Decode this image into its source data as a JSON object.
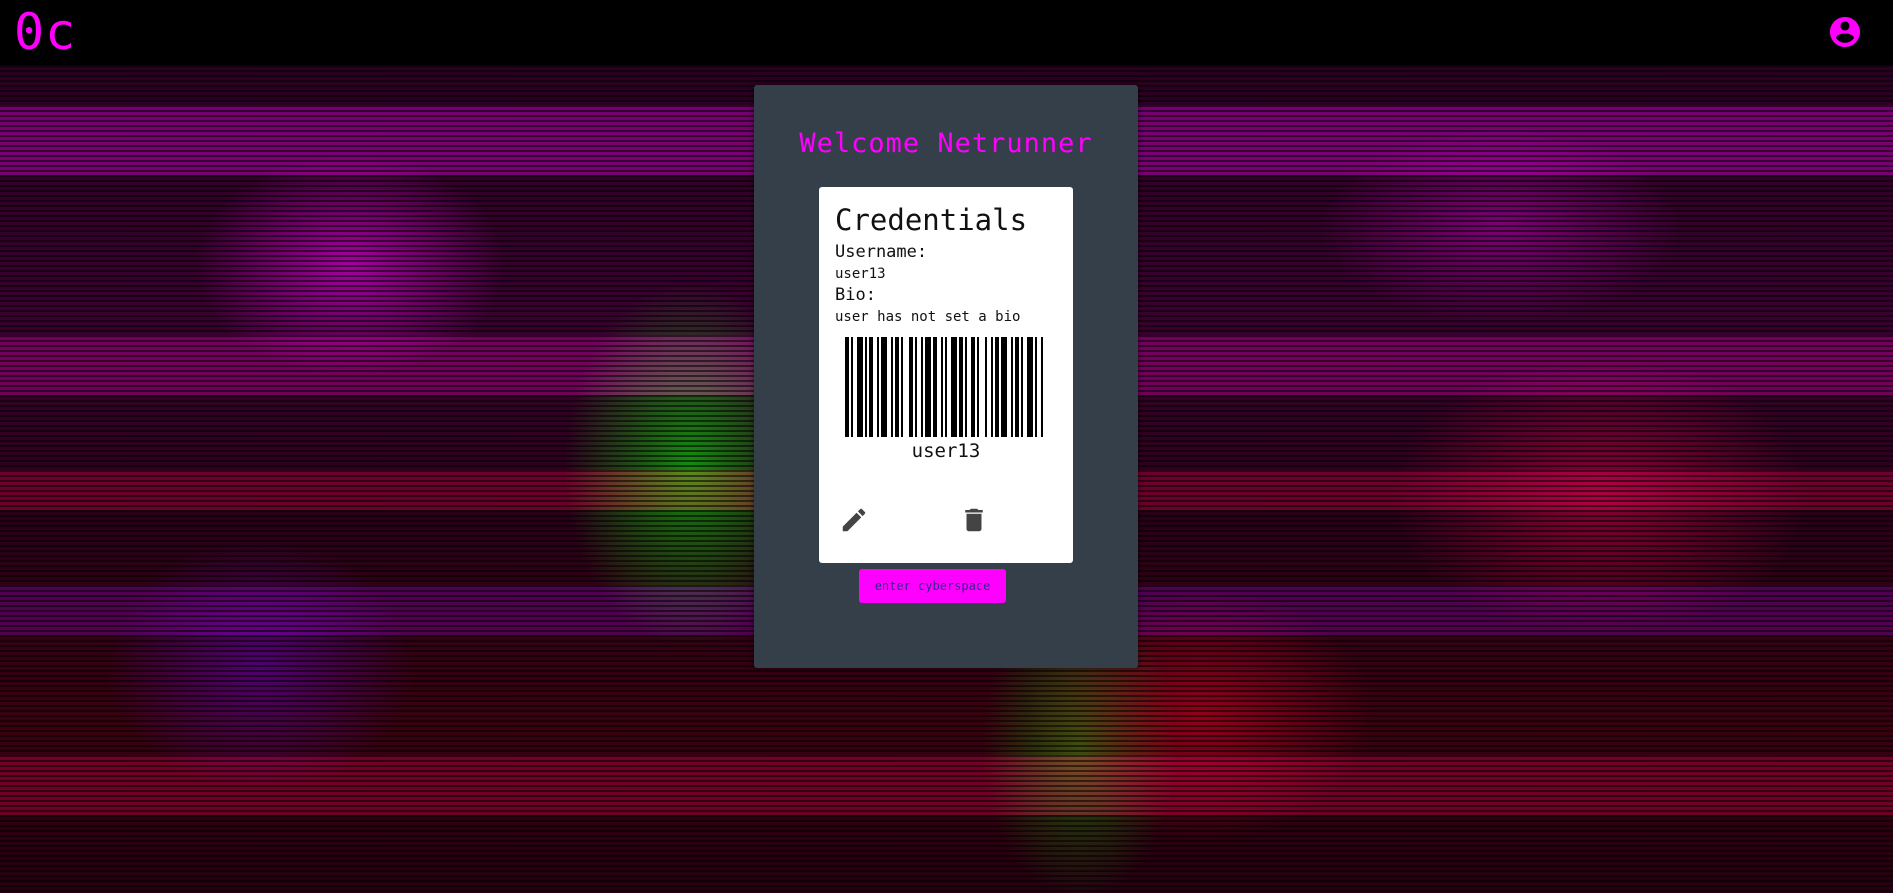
{
  "header": {
    "logo": "0c",
    "avatar_icon": "account-circle-icon"
  },
  "panel": {
    "welcome": "Welcome Netrunner",
    "card": {
      "title": "Credentials",
      "username_label": "Username:",
      "username_value": "user13",
      "bio_label": "Bio:",
      "bio_value": "user has not set a bio",
      "barcode_text": "user13",
      "edit_icon": "pencil-icon",
      "delete_icon": "trash-icon"
    },
    "enter_button": "enter cyberspace"
  },
  "colors": {
    "accent": "#ff00ff",
    "panel": "#343f4a",
    "background": "#000000"
  }
}
